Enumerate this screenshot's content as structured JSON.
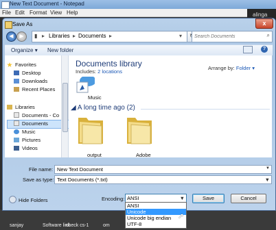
{
  "notepad": {
    "title": "New Text Document - Notepad",
    "menu": [
      "File",
      "Edit",
      "Format",
      "View",
      "Help"
    ]
  },
  "background": {
    "right_text": "alinga"
  },
  "dialog": {
    "title": "Save As",
    "close_label": "x",
    "address": [
      "Libraries",
      "Documents"
    ],
    "search_placeholder": "Search Documents",
    "toolbar": {
      "organize": "Organize",
      "new_folder": "New folder"
    },
    "nav": {
      "favorites": "Favorites",
      "favorites_items": [
        "Desktop",
        "Downloads",
        "Recent Places"
      ],
      "libraries": "Libraries",
      "libraries_items": [
        "Documents - Co",
        "Documents",
        "Music",
        "Pictures",
        "Videos"
      ]
    },
    "library": {
      "title": "Documents library",
      "includes_label": "Includes:",
      "includes_link": "2 locations",
      "arrange_label": "Arrange by:",
      "arrange_value": "Folder",
      "music_tile": "Music",
      "group_header": "A long time ago (2)",
      "folders": [
        "output",
        "Adobe"
      ]
    },
    "fields": {
      "file_name_label": "File name:",
      "file_name_value": "New Text Document",
      "save_type_label": "Save as type:",
      "save_type_value": "Text Documents (*.txt)"
    },
    "hide_folders": "Hide Folders",
    "encoding": {
      "label": "Encoding:",
      "selected": "ANSI",
      "options": [
        "ANSI",
        "Unicode",
        "Unicode big endian",
        "UTF-8"
      ],
      "highlighted_index": 1
    },
    "buttons": {
      "save": "Save",
      "cancel": "Cancel"
    }
  },
  "taskbar": [
    "sanjay",
    "Software link",
    "check cs-1",
    "om"
  ],
  "colors": {
    "accent": "#3399ff",
    "library_title": "#1e3c78",
    "link": "#1a57b5"
  }
}
